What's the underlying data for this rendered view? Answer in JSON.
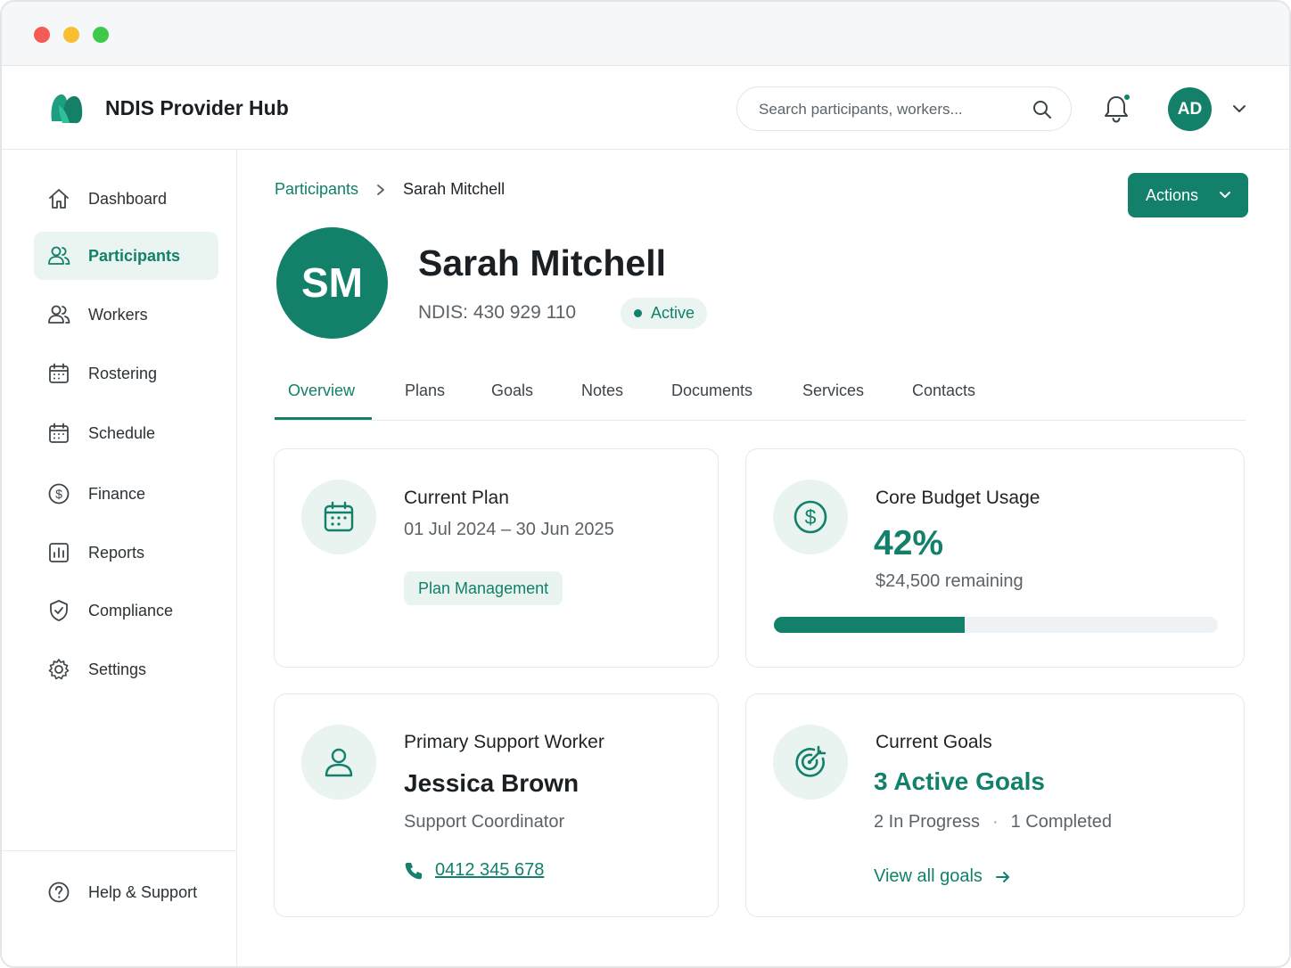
{
  "app": {
    "name": "NDIS Provider Hub"
  },
  "search": {
    "placeholder": "Search participants, workers..."
  },
  "user": {
    "initials": "AD"
  },
  "sidebar": {
    "items": [
      {
        "label": "Dashboard",
        "icon": "home-icon",
        "active": false
      },
      {
        "label": "Participants",
        "icon": "users-icon",
        "active": true
      },
      {
        "label": "Workers",
        "icon": "workers-icon",
        "active": false
      },
      {
        "label": "Rostering",
        "icon": "calendar-icon",
        "active": false
      },
      {
        "label": "Schedule",
        "icon": "calendar-icon",
        "active": false
      },
      {
        "label": "Finance",
        "icon": "dollar-circle-icon",
        "active": false
      },
      {
        "label": "Reports",
        "icon": "bar-chart-icon",
        "active": false
      },
      {
        "label": "Compliance",
        "icon": "shield-check-icon",
        "active": false
      },
      {
        "label": "Settings",
        "icon": "gear-icon",
        "active": false
      }
    ],
    "footer": {
      "label": "Help & Support",
      "icon": "help-circle-icon"
    }
  },
  "breadcrumb": {
    "parent": "Participants",
    "current": "Sarah Mitchell"
  },
  "actions": {
    "label": "Actions"
  },
  "participant": {
    "initials": "SM",
    "name": "Sarah Mitchell",
    "ndis": "NDIS: 430 929 110",
    "status": "Active"
  },
  "tabs": [
    "Overview",
    "Plans",
    "Goals",
    "Notes",
    "Documents",
    "Services",
    "Contacts"
  ],
  "active_tab": "Overview",
  "cards": {
    "plan": {
      "title": "Current Plan",
      "dates": "01 Jul 2024 – 30 Jun 2025",
      "tag": "Plan Management"
    },
    "budget": {
      "title": "Core Budget Usage",
      "percent": "42%",
      "remaining": "$24,500 remaining",
      "usage_fraction": 0.43
    },
    "worker": {
      "title": "Primary Support Worker",
      "name": "Jessica Brown",
      "role": "Support Coordinator",
      "phone": "0412 345 678"
    },
    "goals": {
      "title": "Current Goals",
      "summary": "3 Active Goals",
      "in_progress": "2 In Progress",
      "separator": "·",
      "completed": "1 Completed",
      "link": "View all goals"
    }
  },
  "colors": {
    "accent": "#12806a",
    "accent_light": "#eaf4f1",
    "border": "#e6e8ea"
  }
}
